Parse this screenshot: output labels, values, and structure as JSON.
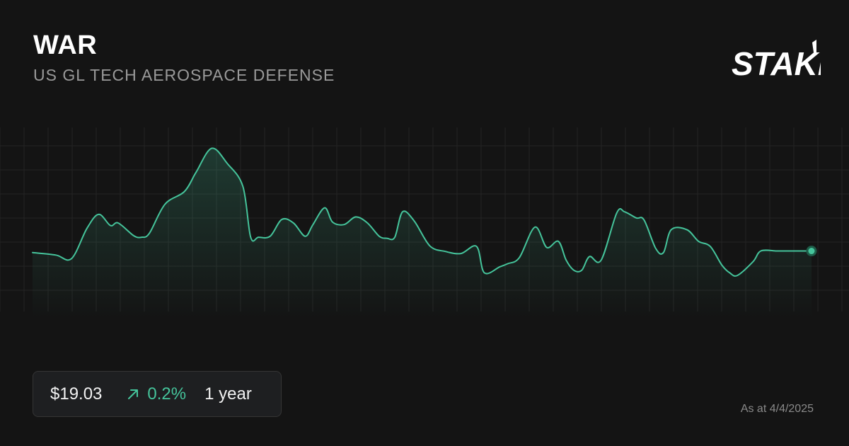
{
  "header": {
    "ticker": "WAR",
    "fund_name": "US GL TECH AEROSPACE DEFENSE",
    "brand": "STAKE"
  },
  "summary": {
    "price": "$19.03",
    "change": "0.2%",
    "change_direction": "up",
    "period": "1 year",
    "as_at": "As at 4/4/2025"
  },
  "colors": {
    "background": "#141414",
    "line": "#45c49b",
    "grid": "#242424"
  },
  "icons": {
    "change": "arrow-up-right-icon",
    "brand": "stake-logo"
  },
  "chart_data": {
    "type": "area",
    "title": "",
    "xlabel": "",
    "ylabel": "",
    "grid": true,
    "legend": "none",
    "ylim": [
      17.7,
      21.6
    ],
    "x": [
      0,
      6,
      10,
      14,
      17,
      20,
      22,
      26,
      28,
      30,
      34,
      39,
      42,
      46,
      50,
      54,
      56,
      58,
      61,
      64,
      67,
      70,
      72,
      75,
      77,
      80,
      83,
      86,
      89,
      91,
      93,
      95,
      98,
      102,
      106,
      110,
      114,
      116,
      120,
      122,
      125,
      129,
      132,
      135,
      137,
      139,
      141,
      143,
      146,
      150,
      152,
      155,
      157,
      160,
      162,
      164,
      168,
      171,
      174,
      177,
      179,
      181,
      185,
      187,
      191,
      193,
      197,
      200
    ],
    "values": [
      19.0,
      18.95,
      18.88,
      19.48,
      19.75,
      19.53,
      19.58,
      19.33,
      19.3,
      19.38,
      19.95,
      20.2,
      20.58,
      21.05,
      20.75,
      20.3,
      19.3,
      19.3,
      19.32,
      19.65,
      19.58,
      19.32,
      19.55,
      19.88,
      19.6,
      19.55,
      19.7,
      19.58,
      19.32,
      19.28,
      19.3,
      19.8,
      19.62,
      19.13,
      19.02,
      18.98,
      19.12,
      18.6,
      18.72,
      18.78,
      18.9,
      19.5,
      19.1,
      19.22,
      18.85,
      18.65,
      18.65,
      18.92,
      18.85,
      19.78,
      19.8,
      19.68,
      19.64,
      19.08,
      19.0,
      19.45,
      19.45,
      19.22,
      19.12,
      18.75,
      18.6,
      18.55,
      18.82,
      19.03,
      19.03,
      19.03,
      19.03,
      19.03
    ],
    "last_point_marker": true
  }
}
